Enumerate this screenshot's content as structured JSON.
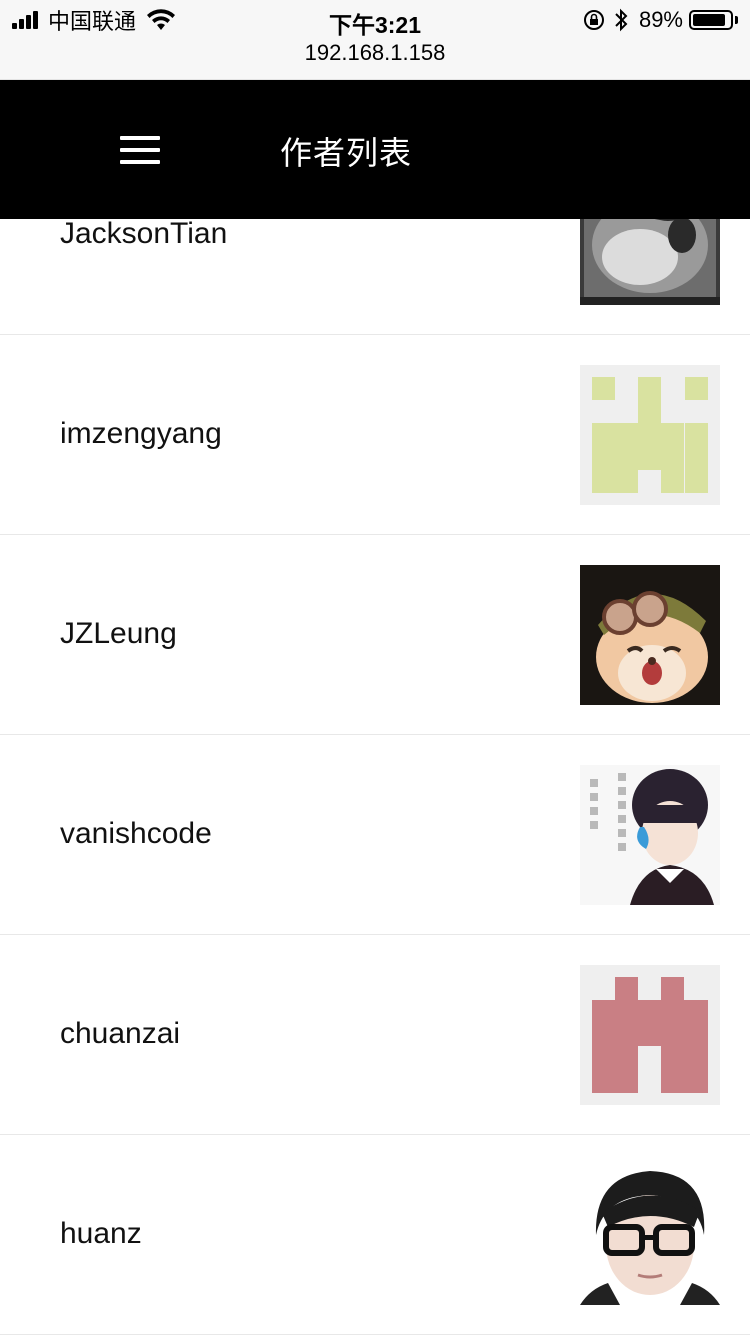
{
  "status_bar": {
    "carrier": "中国联通",
    "time": "下午3:21",
    "url": "192.168.1.158",
    "battery_percent": "89%",
    "battery_level": 0.89
  },
  "header": {
    "title": "作者列表",
    "menu_icon": "hamburger-menu-icon"
  },
  "authors": [
    {
      "name": "JacksonTian"
    },
    {
      "name": "imzengyang"
    },
    {
      "name": "JZLeung"
    },
    {
      "name": "vanishcode"
    },
    {
      "name": "chuanzai"
    },
    {
      "name": "huanz"
    }
  ],
  "colors": {
    "nav_background": "#000000",
    "identicon_green": "#d9e2a0",
    "identicon_red": "#c97f84",
    "identicon_background": "#efefef"
  }
}
